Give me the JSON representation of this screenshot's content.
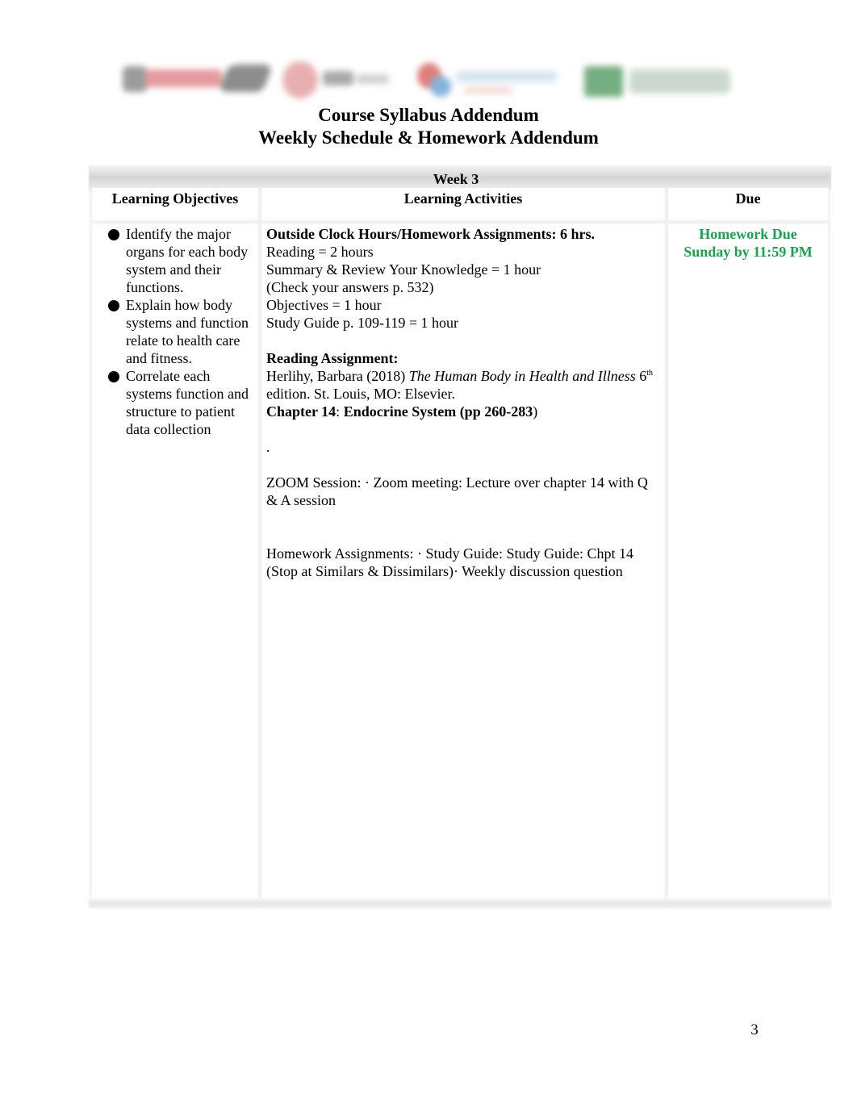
{
  "header": {
    "logos": [
      "institution-logo-1",
      "institution-logo-2",
      "institution-logo-3",
      "institution-logo-4"
    ],
    "title_line1": "Course Syllabus Addendum",
    "title_line2": "Weekly Schedule & Homework Addendum"
  },
  "table": {
    "week_label": "Week 3",
    "columns": {
      "objectives": "Learning Objectives",
      "activities": "Learning Activities",
      "due": "Due"
    },
    "objectives": [
      "Identify the major organs for each body system and their functions.",
      "Explain how body systems and function relate to health care and fitness.",
      "Correlate each systems function and structure to patient data collection"
    ],
    "activities": {
      "hours_heading": "Outside Clock Hours/Homework Assignments: 6 hrs.",
      "hours_items": [
        "Reading = 2 hours",
        "Summary & Review Your Knowledge = 1 hour",
        "(Check your answers p. 532)",
        "Objectives = 1 hour",
        "Study Guide p. 109-119 = 1 hour"
      ],
      "reading_heading": "Reading Assignment:",
      "citation_author": "Herlihy, Barbara (2018) ",
      "citation_title": "The Human Body in Health and Illness",
      "citation_edition_num": " 6",
      "citation_edition_sup": "th",
      "citation_rest": " edition. St. Louis, MO: Elsevier.",
      "chapter_label": "Chapter 14",
      "chapter_sep": ": ",
      "chapter_title": "Endocrine System (pp 260-283",
      "chapter_close": ")",
      "dot": ".",
      "zoom_session": "ZOOM Session: · Zoom meeting: Lecture over chapter 14 with Q & A session",
      "homework": "Homework Assignments: · Study Guide: Study Guide: Chpt 14 (Stop at Similars & Dissimilars)· Weekly discussion question"
    },
    "due": {
      "line1": "Homework Due",
      "line2": "Sunday by 11:59 PM",
      "color": "#16a34a"
    }
  },
  "footer": {
    "page_number": "3"
  }
}
